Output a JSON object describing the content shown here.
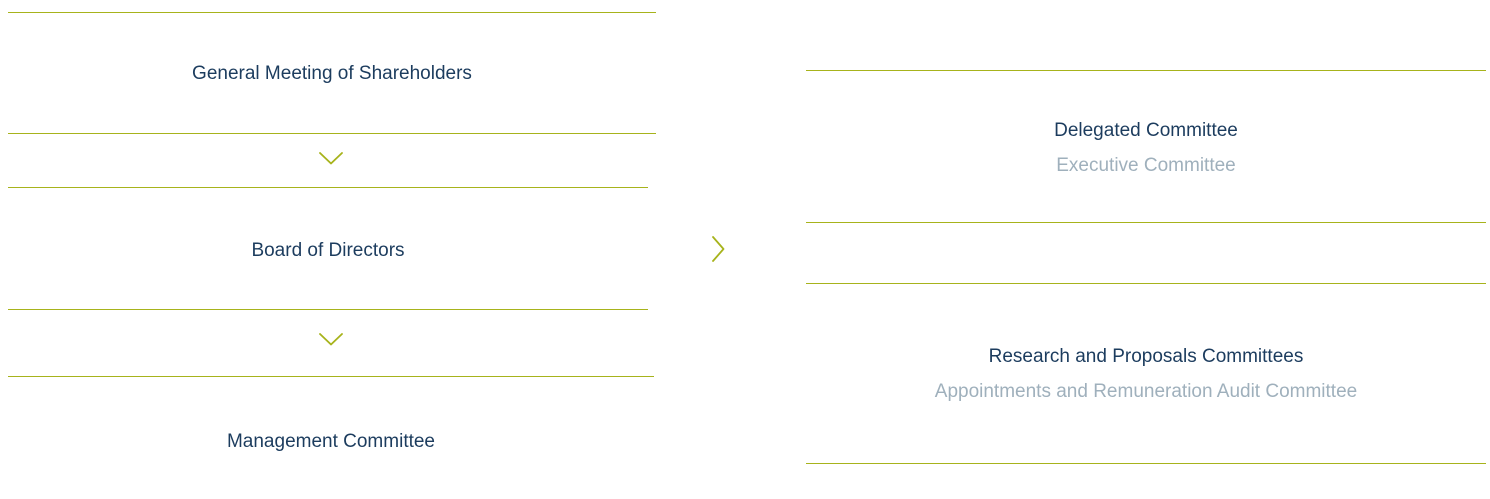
{
  "left_column": {
    "items": [
      {
        "label": "General Meeting of Shareholders"
      },
      {
        "label": "Board of Directors"
      },
      {
        "label": "Management Committee"
      }
    ]
  },
  "right_column": {
    "groups": [
      {
        "title": "Delegated Committee",
        "subtitle": "Executive Committee"
      },
      {
        "title": "Research and Proposals Committees",
        "subtitle": "Appointments and Remuneration Audit Committee"
      }
    ]
  },
  "connectors": {
    "down_icon": "chevron-down",
    "right_icon": "chevron-right",
    "accent_color": "#a7b31b",
    "title_color": "#1c3c5e",
    "subtitle_color": "#9fb0bc"
  }
}
